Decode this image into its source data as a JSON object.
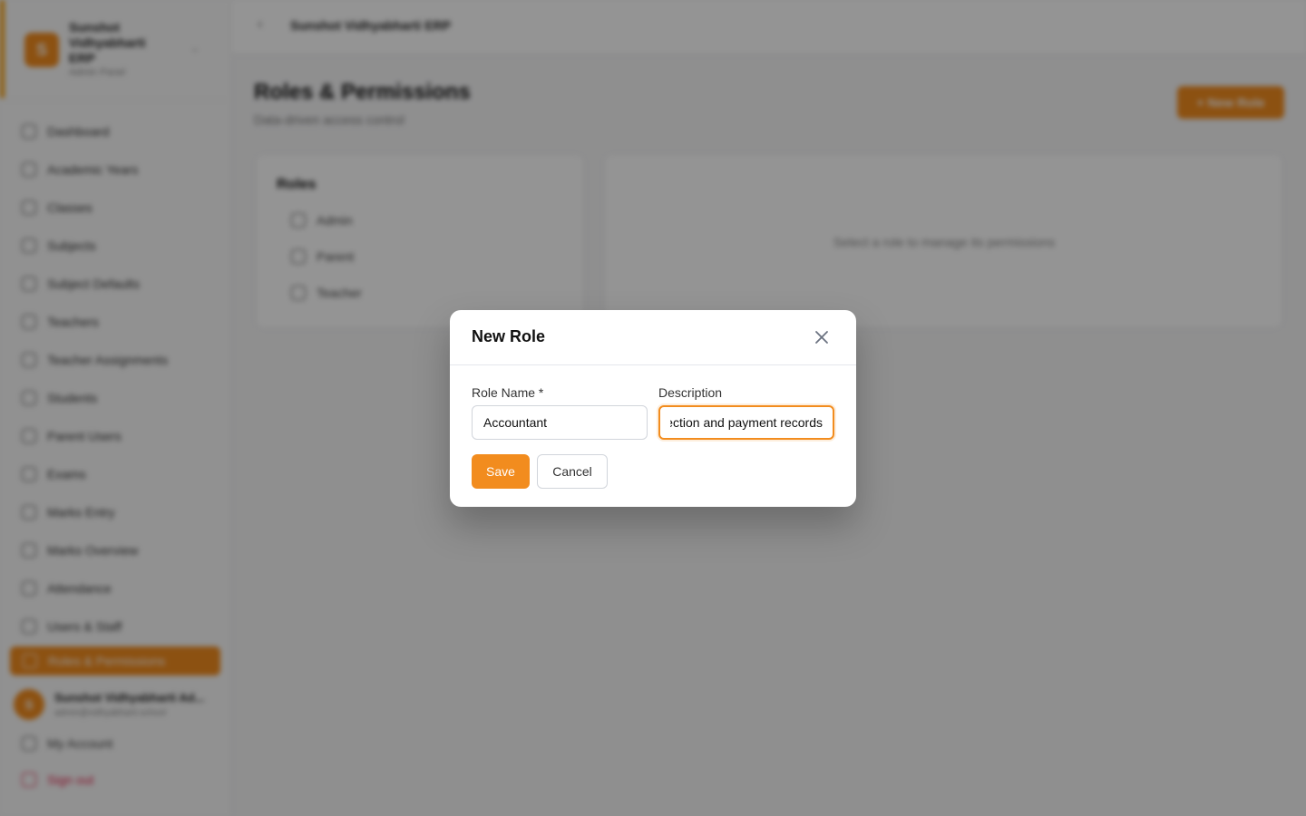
{
  "brand": {
    "logo_letter": "S",
    "name": "Sunshot Vidhyabharti ERP",
    "subtitle": "Admin Panel"
  },
  "topbar": {
    "title": "Sunshot Vidhyabharti ERP"
  },
  "sidebar": {
    "items": [
      {
        "label": "Dashboard",
        "icon": "dashboard-icon"
      },
      {
        "label": "Academic Years",
        "icon": "calendar-icon"
      },
      {
        "label": "Classes",
        "icon": "classes-icon"
      },
      {
        "label": "Subjects",
        "icon": "book-icon"
      },
      {
        "label": "Subject Defaults",
        "icon": "sliders-icon"
      },
      {
        "label": "Teachers",
        "icon": "teacher-icon"
      },
      {
        "label": "Teacher Assignments",
        "icon": "assignment-icon"
      },
      {
        "label": "Students",
        "icon": "students-icon"
      },
      {
        "label": "Parent Users",
        "icon": "parent-icon"
      },
      {
        "label": "Exams",
        "icon": "exam-icon"
      },
      {
        "label": "Marks Entry",
        "icon": "pen-icon"
      },
      {
        "label": "Marks Overview",
        "icon": "chart-icon"
      },
      {
        "label": "Attendance",
        "icon": "attendance-icon"
      },
      {
        "label": "Users & Staff",
        "icon": "users-icon"
      }
    ],
    "active_item": "Roles & Permissions",
    "user": {
      "initial": "S",
      "name": "Sunshot Vidhyabharti Ad...",
      "email": "admin@vidhyabharti.school"
    },
    "my_account": "My Account",
    "sign_out": "Sign out"
  },
  "page": {
    "title": "Roles & Permissions",
    "subtitle": "Data-driven access control",
    "new_role_button": "+ New Role"
  },
  "roles_panel": {
    "title": "Roles",
    "items": [
      "Admin",
      "Parent",
      "Teacher"
    ]
  },
  "permissions_panel": {
    "empty_text": "Select a role to manage its permissions"
  },
  "modal": {
    "title": "New Role",
    "role_name_label": "Role Name *",
    "role_name_value": "Accountant",
    "description_label": "Description",
    "description_value": "Fee collection and payment records",
    "save_label": "Save",
    "cancel_label": "Cancel"
  },
  "colors": {
    "accent": "#f28c1e",
    "danger": "#e11d48"
  }
}
